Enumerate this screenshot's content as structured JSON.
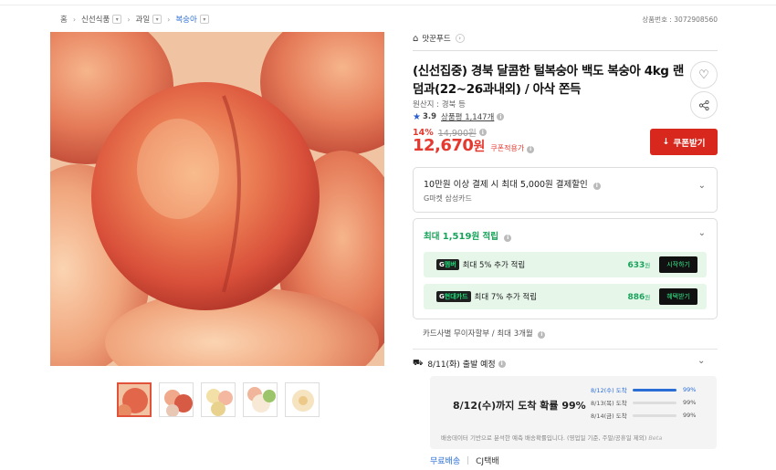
{
  "breadcrumb": {
    "home": "홈",
    "cat1": "신선식품",
    "cat2": "과일",
    "cat3": "복숭아"
  },
  "product_no": "상품번호 : 3072908560",
  "main_image": {
    "alt": "복숭아"
  },
  "thumbnails": [
    "thumb-1",
    "thumb-2",
    "thumb-3",
    "thumb-4",
    "thumb-5"
  ],
  "shop": {
    "name": "맛꾼푸드"
  },
  "title": "(신선집중) 경북 달콤한 털복숭아 백도 복숭아 4kg 랜덤과(22~26과내외) / 아삭 쫀득",
  "origin": "원산지 : 경북 등",
  "rating": {
    "score": "3.9",
    "reviews": "상품평 1,147개"
  },
  "discount": {
    "percent": "14%",
    "original": "14,900원"
  },
  "price": {
    "number": "12,670",
    "unit": "원",
    "coupon_note": "쿠폰적용가"
  },
  "coupon_button": "쿠폰받기",
  "card_promo": {
    "line1": "10만원 이상 결제 시 최대 5,000원 결제할인",
    "line2": "G마켓 삼성카드"
  },
  "points": {
    "prefix": "최대 ",
    "amount": "1,519",
    "suffix": "원 적립",
    "rows": [
      {
        "tag": "멤버",
        "desc": "최대 5% 추가 적립",
        "amount": "633",
        "unit": "원",
        "button": "시작하기"
      },
      {
        "tag": "현대카드",
        "desc": "최대 7% 추가 적립",
        "amount": "886",
        "unit": "원",
        "button": "혜택받기"
      }
    ]
  },
  "installment": "카드사별 무이자할부 / 최대 3개월",
  "shipping": {
    "date": "8/11(화) 출발 예정",
    "headline": "8/12(수)까지 도착 확률 99%",
    "lines": [
      {
        "date": "8/12(수) 도착",
        "percent": "99%",
        "value": 99,
        "highlight": true
      },
      {
        "date": "8/13(목) 도착",
        "percent": "99%",
        "value": 0,
        "highlight": false
      },
      {
        "date": "8/14(금) 도착",
        "percent": "99%",
        "value": 0,
        "highlight": false
      }
    ],
    "note": "배송데이터 기반으로 분석한 예측 배송확률입니다. (영업일 기준, 주말/공휴일 제외)",
    "beta": "Beta"
  },
  "delivery": {
    "free": "무료배송",
    "carrier": "CJ택배"
  },
  "colors": {
    "accent_red": "#e5392f",
    "accent_green": "#18a35a",
    "accent_blue": "#2b6fd6"
  }
}
